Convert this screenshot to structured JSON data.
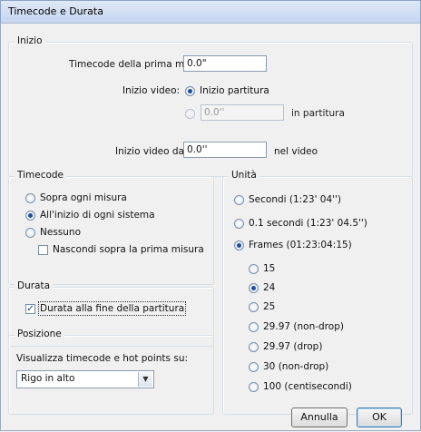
{
  "window": {
    "title": "Timecode e Durata"
  },
  "inizio": {
    "legend": "Inizio",
    "timecode_label": "Timecode della prima misura",
    "timecode_value": "0.0\"",
    "inizio_video_label": "Inizio video:",
    "opt_inizio_partitura": "Inizio partitura",
    "opt_in_partitura_value": "0.0''",
    "opt_in_partitura_suffix": "in partitura",
    "inizio_video_da_label": "Inizio video da:",
    "inizio_video_da_value": "0.0''",
    "nel_video": "nel video"
  },
  "timecode": {
    "legend": "Timecode",
    "opt_sopra": "Sopra ogni misura",
    "opt_inizio_sistema": "All'inizio di ogni sistema",
    "opt_nessuno": "Nessuno",
    "chk_nascondi": "Nascondi sopra la prima misura"
  },
  "durata": {
    "legend": "Durata",
    "chk_durata": "Durata alla fine della partitura"
  },
  "posizione": {
    "legend": "Posizione",
    "label": "Visualizza timecode e hot points su:",
    "selected": "Rigo in alto"
  },
  "unita": {
    "legend": "Unità",
    "opt_secondi": "Secondi (1:23' 04'')",
    "opt_01_secondi": "0.1 secondi (1:23' 04.5'')",
    "opt_frames": "Frames (01:23:04:15)",
    "frame_rates": [
      "15",
      "24",
      "25",
      "29.97 (non-drop)",
      "29.97 (drop)",
      "30 (non-drop)",
      "100 (centisecondi)"
    ],
    "selected_rate": "24"
  },
  "buttons": {
    "cancel": "Annulla",
    "ok": "OK"
  }
}
